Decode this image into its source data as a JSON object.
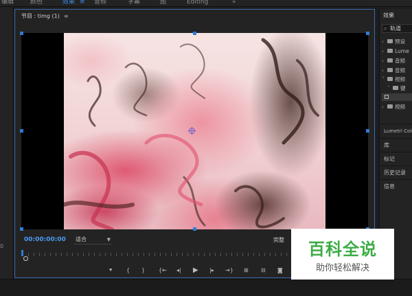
{
  "workspace_tabs": [
    {
      "label": "编辑"
    },
    {
      "label": "颜色"
    },
    {
      "label": "效果",
      "active": true
    },
    {
      "label": "≡"
    },
    {
      "label": "音频"
    },
    {
      "label": "字幕"
    },
    {
      "label": "图"
    },
    {
      "label": "Editing"
    },
    {
      "label": "»"
    }
  ],
  "left_panel": {
    "timecode_fragment": "0"
  },
  "program_monitor": {
    "title": "节目 : timg (1)",
    "menu_glyph": "≡",
    "current_timecode": "00:00:00:00",
    "fit_value": "适合",
    "playback_quality": "完整",
    "transport_controls": [
      {
        "icon": "add-marker-icon",
        "glyph": "⯆"
      },
      {
        "icon": "mark-in-icon",
        "glyph": "{"
      },
      {
        "icon": "mark-out-icon",
        "glyph": "}"
      },
      {
        "icon": "go-to-in-icon",
        "glyph": "{⇤"
      },
      {
        "icon": "step-back-icon",
        "glyph": "◂|"
      },
      {
        "icon": "play-icon",
        "glyph": "▶"
      },
      {
        "icon": "step-forward-icon",
        "glyph": "|▸"
      },
      {
        "icon": "go-to-out-icon",
        "glyph": "⇥}"
      },
      {
        "icon": "lift-icon",
        "glyph": "⊞"
      },
      {
        "icon": "extract-icon",
        "glyph": "⊟"
      },
      {
        "icon": "export-frame-icon",
        "glyph": "◙"
      }
    ]
  },
  "effects_panel": {
    "title": "效果",
    "search_value": "轨道",
    "tree": [
      {
        "label": "预设",
        "expanded": false
      },
      {
        "label": "Lume",
        "expanded": false
      },
      {
        "label": "音频",
        "expanded": false
      },
      {
        "label": "音频",
        "expanded": false
      },
      {
        "label": "视频",
        "expanded": true
      },
      {
        "label": "键",
        "expanded": true,
        "indent": 1
      },
      {
        "label": "",
        "indent": 2,
        "is_effect": true
      },
      {
        "label": "视频",
        "expanded": false
      }
    ],
    "sections": [
      "Lumetri Colo",
      "库",
      "标记",
      "历史记录",
      "信息"
    ]
  },
  "watermark": {
    "title": "百科全说",
    "subtitle": "助你轻松解决"
  },
  "colors": {
    "accent": "#3d8ee6",
    "watermark_green": "#3cac46",
    "panel_bg": "#232323"
  }
}
